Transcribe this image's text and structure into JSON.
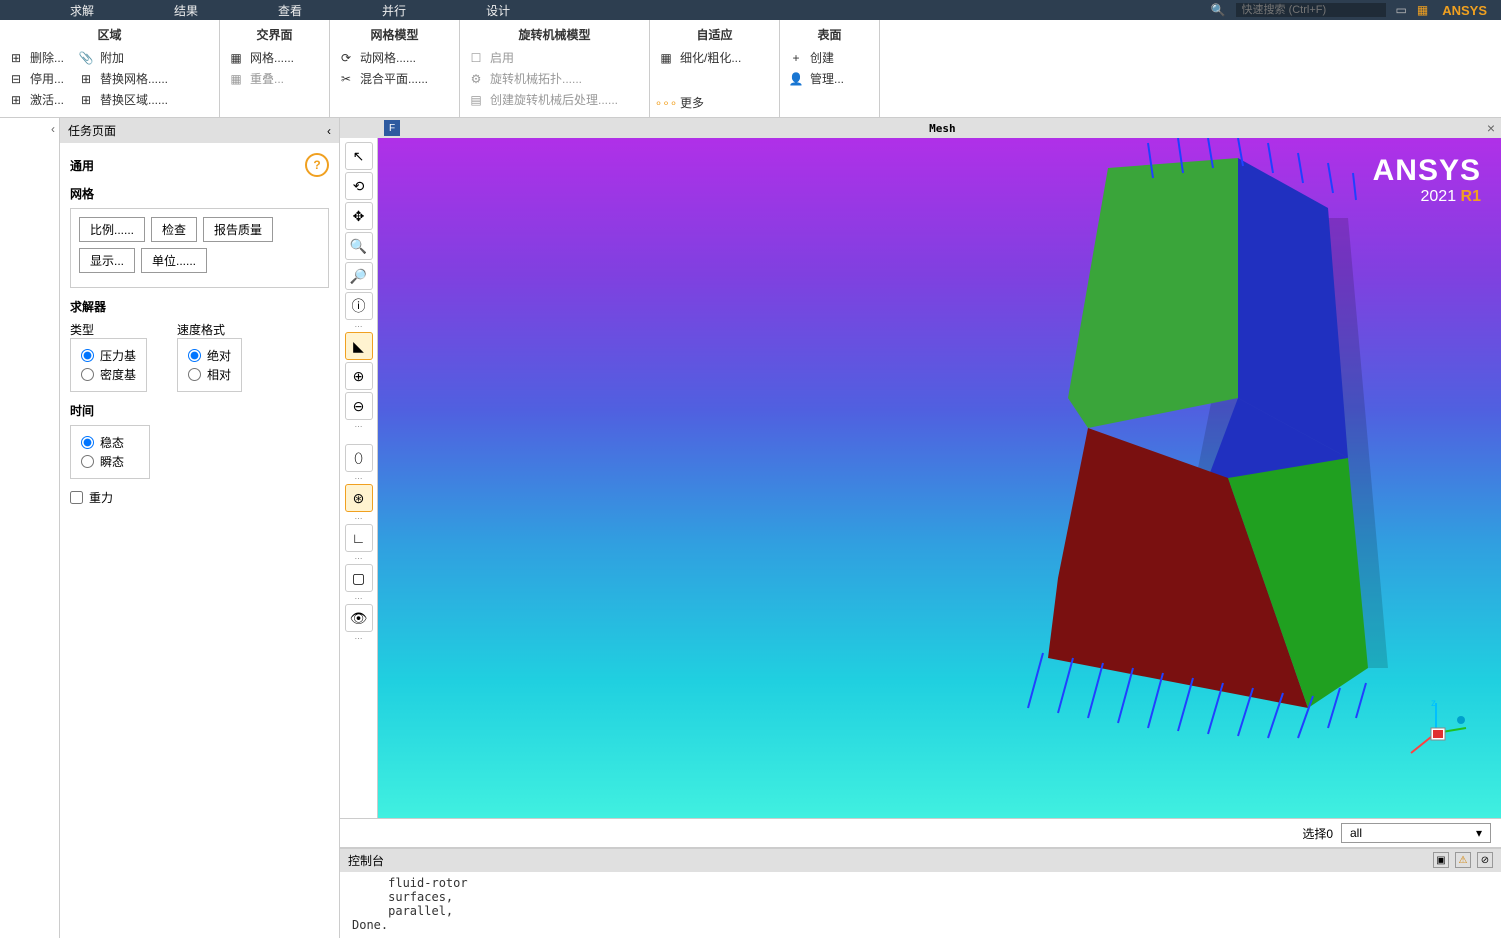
{
  "topMenu": {
    "items": [
      "求解",
      "结果",
      "查看",
      "并行",
      "设计"
    ],
    "searchHint": "快速搜索 (Ctrl+F)",
    "logo": "ANSYS"
  },
  "ribbon": {
    "groups": [
      {
        "title": "区域",
        "items": [
          [
            "删除...",
            "附加"
          ],
          [
            "停用...",
            "替换网格......"
          ],
          [
            "激活...",
            "替换区域......"
          ]
        ]
      },
      {
        "title": "交界面",
        "items": [
          [
            "网格......"
          ],
          [
            "重叠..."
          ]
        ]
      },
      {
        "title": "网格模型",
        "items": [
          [
            "动网格......"
          ],
          [
            "混合平面......"
          ]
        ]
      },
      {
        "title": "旋转机械模型",
        "items": [
          [
            "启用"
          ],
          [
            "旋转机械拓扑......"
          ],
          [
            "创建旋转机械后处理......"
          ]
        ]
      },
      {
        "title": "自适应",
        "items": [
          [
            "细化/粗化..."
          ],
          [
            "更多"
          ]
        ]
      },
      {
        "title": "表面",
        "items": [
          [
            "创建"
          ],
          [
            "管理..."
          ]
        ]
      }
    ]
  },
  "task": {
    "header": "任务页面",
    "general": "通用",
    "mesh": {
      "label": "网格",
      "btns1": [
        "比例......",
        "检查",
        "报告质量"
      ],
      "btns2": [
        "显示...",
        "单位......"
      ]
    },
    "solver": {
      "label": "求解器",
      "typeLabel": "类型",
      "typeOptions": [
        "压力基",
        "密度基"
      ],
      "velLabel": "速度格式",
      "velOptions": [
        "绝对",
        "相对"
      ]
    },
    "time": {
      "label": "时间",
      "options": [
        "稳态",
        "瞬态"
      ]
    },
    "gravity": "重力"
  },
  "viewport": {
    "title": "Mesh",
    "brand": "ANSYS",
    "version": "2021 R1"
  },
  "selection": {
    "label": "选择0",
    "value": "all"
  },
  "console": {
    "title": "控制台",
    "lines": "     fluid-rotor\n     surfaces,\n     parallel,\nDone."
  }
}
